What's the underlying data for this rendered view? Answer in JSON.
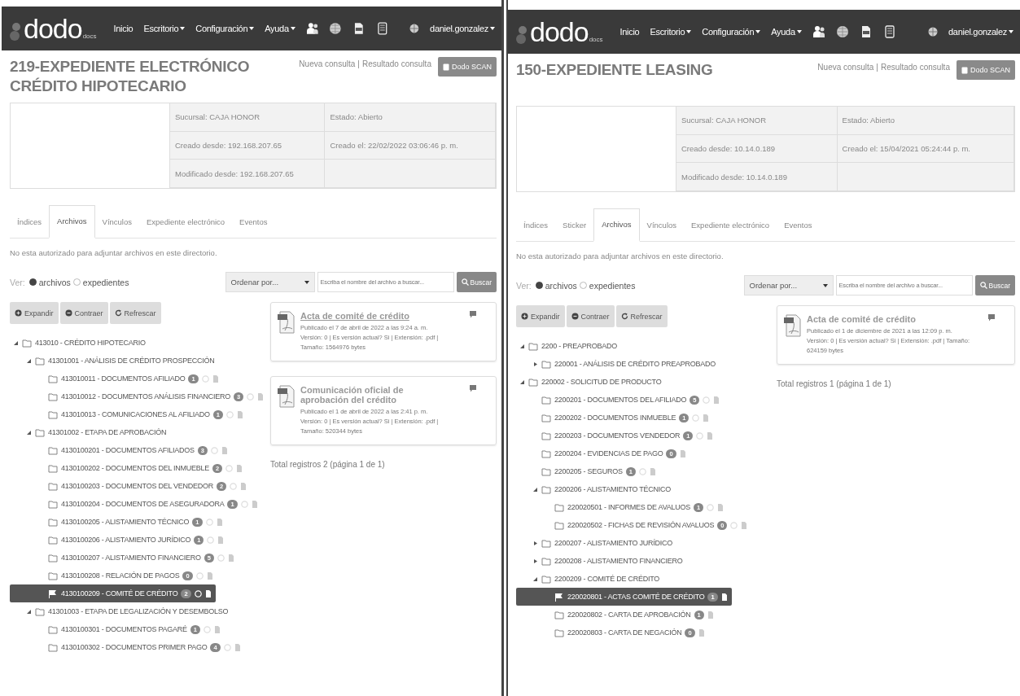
{
  "panels": [
    {
      "navbar": {
        "logo": "dodo",
        "logo_sub": "docs",
        "menu": [
          {
            "label": "Inicio",
            "dropdown": false
          },
          {
            "label": "Escritorio",
            "dropdown": true
          },
          {
            "label": "Configuración",
            "dropdown": true
          },
          {
            "label": "Ayuda",
            "dropdown": true
          }
        ],
        "user": "daniel.gonzalez"
      },
      "title": "219-EXPEDIENTE ELECTRÓNICO CRÉDITO HIPOTECARIO",
      "links": [
        "Nueva consulta",
        "Resultado consulta"
      ],
      "links_separator": "|",
      "scan_button": "Dodo SCAN",
      "info": [
        [
          "Sucursal: CAJA HONOR",
          "Estado: Abierto"
        ],
        [
          "Creado desde: 192.168.207.65",
          "Creado el: 22/02/2022 03:06:46 p. m."
        ],
        [
          "Modificado desde: 192.168.207.65"
        ]
      ],
      "tabs": [
        {
          "label": "Índices",
          "selected": false
        },
        {
          "label": "Archivos",
          "selected": true
        },
        {
          "label": "Vínculos",
          "selected": false
        },
        {
          "label": "Expediente electrónico",
          "selected": false
        },
        {
          "label": "Eventos",
          "selected": false
        }
      ],
      "notice": "No esta autorizado para adjuntar archivos en este directorio.",
      "view": {
        "label": "Ver:",
        "options": [
          {
            "label": "archivos",
            "selected": true
          },
          {
            "label": "expedientes",
            "selected": false
          }
        ]
      },
      "sort_placeholder": "Ordenar por...",
      "search_placeholder": "Escriba el nombre del archivo a buscar...",
      "search_button": "Buscar",
      "tree_buttons": [
        {
          "label": "Expandir",
          "kind": "expand"
        },
        {
          "label": "Contraer",
          "kind": "collapse"
        },
        {
          "label": "Refrescar",
          "kind": "refresh"
        }
      ],
      "tree": [
        {
          "kind": "branch",
          "label": "413010 - CRÉDITO HIPOTECARIO",
          "expanded": true,
          "selected": false,
          "children": [
            {
              "kind": "branch",
              "label": "41301001 - ANÁLISIS DE CRÉDITO PROSPECCIÓN",
              "expanded": true,
              "selected": false,
              "children": [
                {
                  "kind": "leaf",
                  "label": "413010011 - DOCUMENTOS AFILIADO",
                  "count": "1",
                  "circle": true,
                  "selected": false
                },
                {
                  "kind": "leaf",
                  "label": "413010012 - DOCUMENTOS ANÁLISIS FINANCIERO",
                  "count": "3",
                  "circle": true,
                  "selected": false
                },
                {
                  "kind": "leaf",
                  "label": "413010013 - COMUNICACIONES AL AFILIADO",
                  "count": "1",
                  "circle": true,
                  "selected": false
                }
              ]
            },
            {
              "kind": "branch",
              "label": "41301002 - ETAPA DE APROBACIÓN",
              "expanded": true,
              "selected": false,
              "children": [
                {
                  "kind": "leaf",
                  "label": "4130100201 - DOCUMENTOS AFILIADOS",
                  "count": "3",
                  "circle": true,
                  "selected": false
                },
                {
                  "kind": "leaf",
                  "label": "4130100202 - DOCUMENTOS DEL INMUEBLE",
                  "count": "2",
                  "circle": true,
                  "selected": false
                },
                {
                  "kind": "leaf",
                  "label": "4130100203 - DOCUMENTOS DEL VENDEDOR",
                  "count": "2",
                  "circle": true,
                  "selected": false
                },
                {
                  "kind": "leaf",
                  "label": "4130100204 - DOCUMENTOS DE ASEGURADORA",
                  "count": "1",
                  "circle": true,
                  "selected": false
                },
                {
                  "kind": "leaf",
                  "label": "4130100205 - ALISTAMIENTO TÉCNICO",
                  "count": "1",
                  "circle": true,
                  "selected": false
                },
                {
                  "kind": "leaf",
                  "label": "4130100206 - ALISTAMIENTO JURÍDICO",
                  "count": "1",
                  "circle": true,
                  "selected": false
                },
                {
                  "kind": "leaf",
                  "label": "4130100207 - ALISTAMIENTO FINANCIERO",
                  "count": "5",
                  "circle": true,
                  "selected": false
                },
                {
                  "kind": "leaf",
                  "label": "4130100208 - RELACIÓN DE PAGOS",
                  "count": "0",
                  "circle": true,
                  "selected": false
                },
                {
                  "kind": "leaf",
                  "label": "4130100209 - COMITÉ DE CRÉDITO",
                  "count": "2",
                  "circle": true,
                  "selected": true
                }
              ]
            },
            {
              "kind": "branch",
              "label": "41301003 - ETAPA DE LEGALIZACIÓN Y DESEMBOLSO",
              "expanded": true,
              "selected": false,
              "children": [
                {
                  "kind": "leaf",
                  "label": "4130100301 - DOCUMENTOS PAGARÉ",
                  "count": "1",
                  "circle": true,
                  "selected": false
                },
                {
                  "kind": "leaf",
                  "label": "4130100302 - DOCUMENTOS PRIMER PAGO",
                  "count": "4",
                  "circle": true,
                  "selected": false
                }
              ]
            }
          ]
        }
      ],
      "files": [
        {
          "title": "Acta de comité de crédito",
          "underlined": true,
          "published": "Publicado el 7 de abril de 2022 a las 9:24 a. m.",
          "meta": "Versión: 0 | Es versión actual? Si | Extensión: .pdf | Tamaño: 1564976 bytes"
        },
        {
          "title": "Comunicación oficial de aprobación del crédito",
          "underlined": false,
          "published": "Publicado el 1 de abril de 2022 a las 2:41 p. m.",
          "meta": "Versión: 0 | Es versión actual? Si | Extensión: .pdf | Tamaño: 520344 bytes"
        }
      ],
      "total": "Total registros 2 (página 1 de 1)"
    },
    {
      "navbar": {
        "logo": "dodo",
        "logo_sub": "docs",
        "menu": [
          {
            "label": "Inicio",
            "dropdown": false
          },
          {
            "label": "Escritorio",
            "dropdown": true
          },
          {
            "label": "Configuración",
            "dropdown": true
          },
          {
            "label": "Ayuda",
            "dropdown": true
          }
        ],
        "user": "daniel.gonzalez"
      },
      "title": "150-EXPEDIENTE LEASING",
      "links": [
        "Nueva consulta",
        "Resultado consulta"
      ],
      "links_separator": "|",
      "scan_button": "Dodo SCAN",
      "info": [
        [
          "Sucursal: CAJA HONOR",
          "Estado: Abierto"
        ],
        [
          "Creado desde: 10.14.0.189",
          "Creado el: 15/04/2021 05:24:44 p. m."
        ],
        [
          "Modificado desde: 10.14.0.189"
        ]
      ],
      "tabs": [
        {
          "label": "Índices",
          "selected": false
        },
        {
          "label": "Sticker",
          "selected": false
        },
        {
          "label": "Archivos",
          "selected": true
        },
        {
          "label": "Vínculos",
          "selected": false
        },
        {
          "label": "Expediente electrónico",
          "selected": false
        },
        {
          "label": "Eventos",
          "selected": false
        }
      ],
      "notice": "No esta autorizado para adjuntar archivos en este directorio.",
      "view": {
        "label": "Ver:",
        "options": [
          {
            "label": "archivos",
            "selected": true
          },
          {
            "label": "expedientes",
            "selected": false
          }
        ]
      },
      "sort_placeholder": "Ordenar por...",
      "search_placeholder": "Escriba el nombre del archivo a buscar...",
      "search_button": "Buscar",
      "tree_buttons": [
        {
          "label": "Expandir",
          "kind": "expand"
        },
        {
          "label": "Contraer",
          "kind": "collapse"
        },
        {
          "label": "Refrescar",
          "kind": "refresh"
        }
      ],
      "tree": [
        {
          "kind": "branch",
          "label": "2200 - PREAPROBADO",
          "expanded": true,
          "selected": false,
          "children": [
            {
              "kind": "branch",
              "label": "220001 - ANÁLISIS DE CRÉDITO PREAPROBADO",
              "expanded": false,
              "selected": false
            }
          ]
        },
        {
          "kind": "branch",
          "label": "220002 - SOLICITUD DE PRODUCTO",
          "expanded": true,
          "selected": false,
          "children": [
            {
              "kind": "leaf",
              "label": "2200201 - DOCUMENTOS DEL AFILIADO",
              "count": "5",
              "circle": true,
              "selected": false
            },
            {
              "kind": "leaf",
              "label": "2200202 - DOCUMENTOS INMUEBLE",
              "count": "1",
              "circle": true,
              "selected": false
            },
            {
              "kind": "leaf",
              "label": "2200203 - DOCUMENTOS VENDEDOR",
              "count": "1",
              "circle": true,
              "selected": false
            },
            {
              "kind": "leaf",
              "label": "2200204 - EVIDENCIAS DE PAGO",
              "count": "0",
              "circle": false,
              "selected": false
            },
            {
              "kind": "leaf",
              "label": "2200205 - SEGUROS",
              "count": "1",
              "circle": true,
              "selected": false
            },
            {
              "kind": "branch",
              "label": "2200206 - ALISTAMIENTO TÉCNICO",
              "expanded": true,
              "selected": false,
              "children": [
                {
                  "kind": "leaf",
                  "label": "220020501 - INFORMES DE AVALUOS",
                  "count": "1",
                  "circle": true,
                  "selected": false
                },
                {
                  "kind": "leaf",
                  "label": "220020502 - FICHAS DE REVISIÓN AVALUOS",
                  "count": "0",
                  "circle": true,
                  "selected": false
                }
              ]
            },
            {
              "kind": "branch",
              "label": "2200207 - ALISTAMIENTO JURÍDICO",
              "expanded": false,
              "selected": false
            },
            {
              "kind": "branch",
              "label": "2200208 - ALISTAMIENTO FINANCIERO",
              "expanded": false,
              "selected": false
            },
            {
              "kind": "branch",
              "label": "2200209 - COMITÉ DE CRÉDITO",
              "expanded": true,
              "selected": false,
              "children": [
                {
                  "kind": "leaf",
                  "label": "220020801 - ACTAS COMITÉ DE CRÉDITO",
                  "count": "1",
                  "circle": false,
                  "selected": true
                },
                {
                  "kind": "leaf",
                  "label": "220020802 - CARTA DE APROBACIÓN",
                  "count": "1",
                  "circle": false,
                  "selected": false
                },
                {
                  "kind": "leaf",
                  "label": "220020803 - CARTA DE NEGACIÓN",
                  "count": "0",
                  "circle": false,
                  "selected": false
                }
              ]
            }
          ]
        }
      ],
      "files": [
        {
          "title": "Acta de comité de crédito",
          "underlined": false,
          "published": "Publicado el 1 de diciembre de 2021 a las 12:09 p. m.",
          "meta": "Versión: 0 | Es versión actual? Si | Extensión: .pdf | Tamaño: 624159 bytes"
        }
      ],
      "total": "Total registros 1 (página 1 de 1)"
    }
  ]
}
